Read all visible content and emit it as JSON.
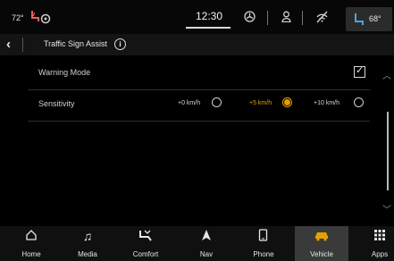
{
  "status_bar": {
    "driver_temp": "72°",
    "clock": "12:30",
    "passenger_temp": "68°",
    "icons": [
      "heated-seat-icon",
      "heated-steering-icon",
      "climate-fan-icon",
      "user-profile-icon",
      "no-wifi-icon",
      "seat-recline-icon"
    ]
  },
  "header": {
    "title": "Traffic Sign Assist",
    "info_symbol": "i"
  },
  "settings": {
    "warning_mode": {
      "label": "Warning Mode",
      "checked": true
    },
    "sensitivity": {
      "label": "Sensitivity",
      "options": [
        {
          "label": "+0 km/h",
          "selected": false
        },
        {
          "label": "+5 km/h",
          "selected": true
        },
        {
          "label": "+10 km/h",
          "selected": false
        }
      ]
    }
  },
  "nav": {
    "items": [
      {
        "label": "Home",
        "icon": "home-icon",
        "active": false
      },
      {
        "label": "Media",
        "icon": "music-note-icon",
        "active": false
      },
      {
        "label": "Comfort",
        "icon": "comfort-icon",
        "active": false
      },
      {
        "label": "Nav",
        "icon": "navigation-arrow-icon",
        "active": false
      },
      {
        "label": "Phone",
        "icon": "phone-icon",
        "active": false
      },
      {
        "label": "Vehicle",
        "icon": "vehicle-icon",
        "active": true
      },
      {
        "label": "Apps",
        "icon": "apps-grid-icon",
        "active": false
      }
    ]
  },
  "colors": {
    "accent": "#e8a000",
    "background": "#000000",
    "active_tab": "#3a3a3a"
  }
}
